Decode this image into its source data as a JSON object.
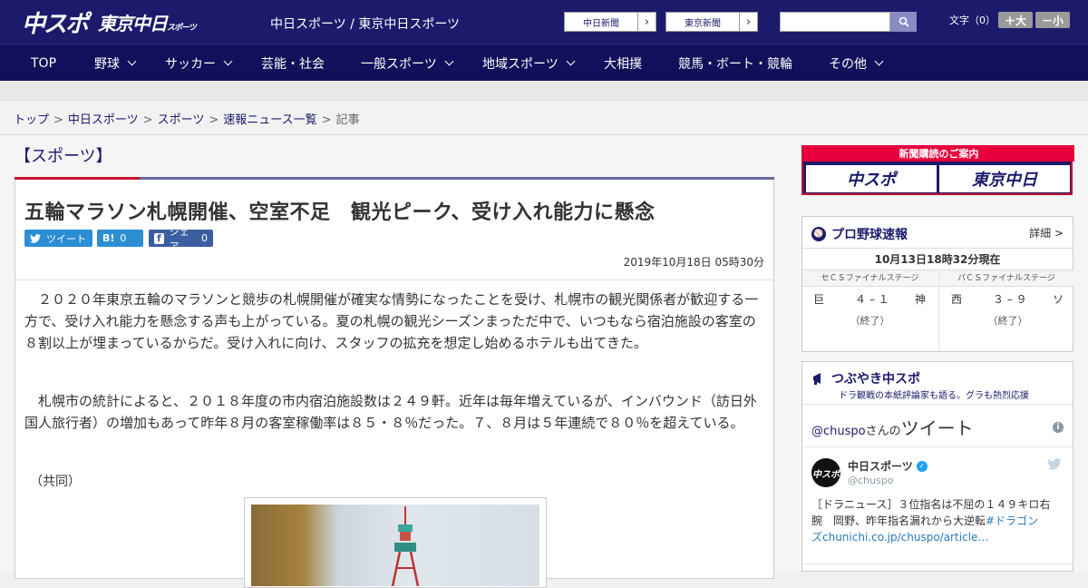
{
  "header": {
    "logo_chuspo": "中スポ",
    "logo_tokyo": "東京中日",
    "logo_tokyo_sub": "スポーツ",
    "site_name": "中日スポーツ / 東京中日スポーツ",
    "paper_links": [
      "中日新聞",
      "東京新聞"
    ],
    "search_placeholder": "",
    "fontsize_label": "文字（0）",
    "font_up": "＋大",
    "font_down": "－小"
  },
  "nav": {
    "items": [
      {
        "label": "TOP",
        "dropdown": false
      },
      {
        "label": "野球",
        "dropdown": true
      },
      {
        "label": "サッカー",
        "dropdown": true
      },
      {
        "label": "芸能・社会",
        "dropdown": false
      },
      {
        "label": "一般スポーツ",
        "dropdown": true
      },
      {
        "label": "地域スポーツ",
        "dropdown": true
      },
      {
        "label": "大相撲",
        "dropdown": false
      },
      {
        "label": "競馬・ボート・競輪",
        "dropdown": false
      },
      {
        "label": "その他",
        "dropdown": true
      }
    ]
  },
  "breadcrumb": {
    "items": [
      "トップ",
      "中日スポーツ",
      "スポーツ",
      "速報ニュース一覧"
    ],
    "current": "記事"
  },
  "article": {
    "section": "【スポーツ】",
    "headline": "五輪マラソン札幌開催、空室不足　観光ピーク、受け入れ能力に懸念",
    "share": {
      "tweet": "ツイート",
      "hatena_icon": "B!",
      "hatena_count": "0",
      "facebook": "シェア",
      "facebook_count": "0"
    },
    "date": "2019年10月18日 05時30分",
    "paragraphs": [
      "　２０２０年東京五輪のマラソンと競歩の札幌開催が確実な情勢になったことを受け、札幌市の観光関係者が歓迎する一方で、受け入れ能力を懸念する声も上がっている。夏の札幌の観光シーズンまっただ中で、いつもなら宿泊施設の客室の８割以上が埋まっているからだ。受け入れに向け、スタッフの拡充を想定し始めるホテルも出てきた。",
      "　札幌市の統計によると、２０１８年度の市内宿泊施設数は２４９軒。近年は毎年増えているが、インバウンド（訪日外国人旅行者）の増加もあって昨年８月の客室稼働率は８５・８％だった。７、８月は５年連続で８０％を超えている。"
    ],
    "credit": "（共同）"
  },
  "sidebar": {
    "ad": {
      "title": "新聞購読のご案内",
      "box1": "中スポ",
      "box2": "東京中日"
    },
    "baseball": {
      "title": "プロ野球速報",
      "detail": "詳細 >",
      "as_of": "10月13日18時32分現在",
      "games": [
        {
          "stage": "セＣＳファイナルステージ",
          "home": "巨",
          "score": "４ – １",
          "away": "神",
          "status": "（終了）"
        },
        {
          "stage": "パＣＳファイナルステージ",
          "home": "西",
          "score": "３ – ９",
          "away": "ソ",
          "status": "（終了）"
        }
      ]
    },
    "twitter": {
      "title": "つぶやき中スポ",
      "subtitle": "ドラ観戦の本紙評論家も語る。グラも熱烈応援",
      "handle": "@chuspo",
      "handle_suffix": "さんの",
      "tweet_word": "ツイート",
      "account_name": "中日スポーツ",
      "account_handle": "@chuspo",
      "avatar_text": "中スポ",
      "tweet_text_1": "［ドラニュース］３位指名は不屈の１４９キロ右",
      "tweet_text_2": "腕　岡野、昨年指名漏れから大逆転",
      "tweet_hashtag": "#ドラゴン",
      "tweet_link": "ズchunichi.co.jp/chuspo/article…"
    }
  }
}
